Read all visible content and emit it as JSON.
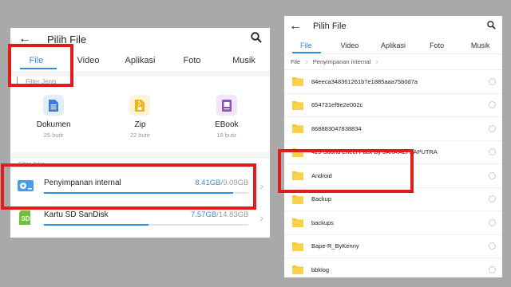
{
  "left": {
    "header": {
      "title": "Pilih File",
      "back_icon": "back-arrow-icon",
      "search_icon": "search-icon"
    },
    "tabs": [
      {
        "label": "File",
        "active": true
      },
      {
        "label": "Video",
        "active": false
      },
      {
        "label": "Aplikasi",
        "active": false
      },
      {
        "label": "Foto",
        "active": false
      },
      {
        "label": "Musik",
        "active": false
      }
    ],
    "filter": {
      "heading": "Filter Jenis",
      "types": [
        {
          "name": "Dokumen",
          "count": "25 butir",
          "icon": "document-icon",
          "color": "#3a7be0",
          "bg": "#e4eefb"
        },
        {
          "name": "Zip",
          "count": "22 butir",
          "icon": "zip-icon",
          "color": "#f1b316",
          "bg": "#fdf3d8"
        },
        {
          "name": "EBook",
          "count": "18 butir",
          "icon": "ebook-icon",
          "color": "#8d4fc4",
          "bg": "#efe6f8"
        }
      ]
    },
    "storage": {
      "heading": "Filter Jalur",
      "items": [
        {
          "name": "Penyimpanan internal",
          "used": "8.41GB",
          "total": "/9.09GB",
          "fraction": 0.925,
          "icon": "internal-storage-icon"
        },
        {
          "name": "Kartu SD SanDisk",
          "used": "7.57GB",
          "total": "/14.83GB",
          "fraction": 0.51,
          "icon": "sd-card-icon",
          "icon_text": "SD"
        }
      ]
    }
  },
  "right": {
    "header": {
      "title": "Pilih File",
      "back_icon": "back-arrow-icon",
      "search_icon": "search-icon"
    },
    "tabs": [
      {
        "label": "File",
        "active": true
      },
      {
        "label": "Video",
        "active": false
      },
      {
        "label": "Aplikasi",
        "active": false
      },
      {
        "label": "Foto",
        "active": false
      },
      {
        "label": "Musik",
        "active": false
      }
    ],
    "breadcrumb": [
      "File",
      "Penyimpanan internal"
    ],
    "folders": [
      "84eeca348361261b7e1885aaa75b0d7a",
      "654731ef9e2e002c",
      "868883047838834",
      "429 Sound Effect Pack By JAKA ALI SAPUTRA",
      "Android",
      "Backup",
      "backups",
      "Bape-R_ByKenny",
      "bbklog"
    ]
  },
  "colors": {
    "accent": "#2f8de4",
    "folder": "#f6c72a",
    "highlight": "#e21b1b",
    "background": "#a9a9a9"
  }
}
